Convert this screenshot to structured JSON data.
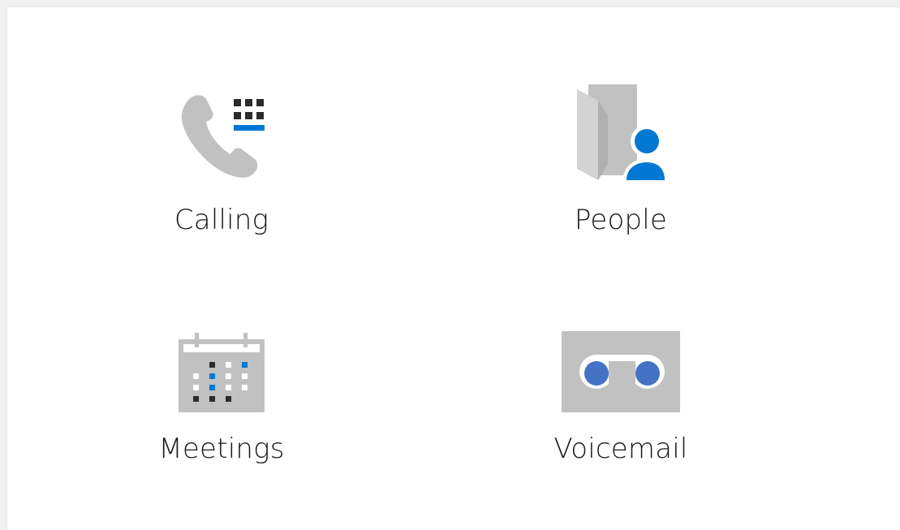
{
  "tiles": [
    {
      "label": "Calling",
      "icon": "phone-dialpad-icon"
    },
    {
      "label": "People",
      "icon": "contacts-book-icon"
    },
    {
      "label": "Meetings",
      "icon": "calendar-icon"
    },
    {
      "label": "Voicemail",
      "icon": "voicemail-icon"
    }
  ],
  "colors": {
    "accent": "#0078d4",
    "voicemail_accent": "#4472c4",
    "icon_gray": "#c1c1c1",
    "icon_dark": "#2b2b2b",
    "text": "#1a1a1a"
  }
}
